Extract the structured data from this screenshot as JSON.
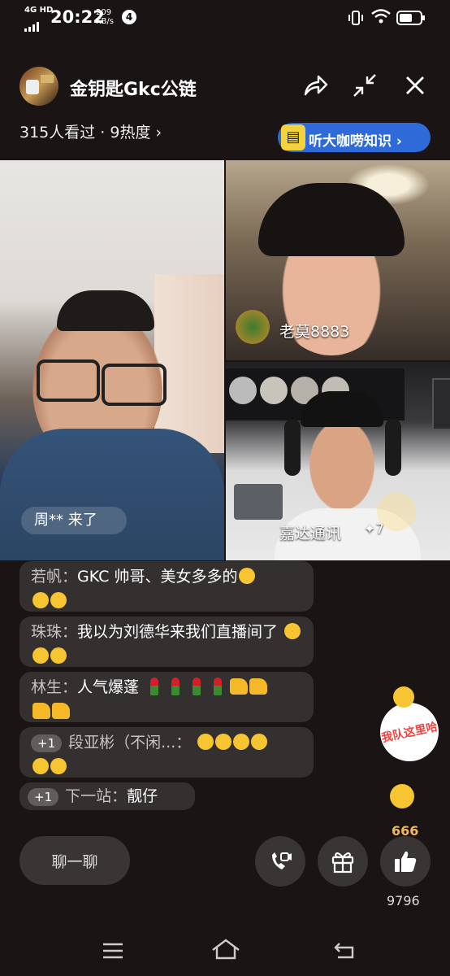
{
  "status_bar": {
    "network": "4G HD",
    "time": "20:22",
    "speed_value": "209",
    "speed_unit": "KB/s",
    "notification_count": "4"
  },
  "header": {
    "title": "金钥匙Gkc公链",
    "stats": "315人看过 · 9热度 ›",
    "promo_label": "听大咖唠知识 ›"
  },
  "videos": {
    "main": {
      "toast": "周** 来了"
    },
    "top_right": {
      "name": "老莫8883"
    },
    "bottom_right": {
      "name": "嘉达通讯",
      "badge": "✦7"
    }
  },
  "chat": [
    {
      "user": "若帆：",
      "text": "GKC 帅哥、美女多多的"
    },
    {
      "user": "珠珠：",
      "text": "我以为刘德华来我们直播间了"
    },
    {
      "user": "林生：",
      "text": "人气爆蓬"
    },
    {
      "plus": "+1",
      "user": "段亚彬（不闲...：",
      "text": ""
    },
    {
      "plus": "+1",
      "user": "下一站：",
      "text": "靓仔"
    }
  ],
  "floating_sticker": {
    "text": "我队这里哈"
  },
  "bottom": {
    "chat_button": "聊一聊",
    "like_count": "9796",
    "like_burst": "666"
  },
  "colors": {
    "promo": "#2f6bd8",
    "background": "#1a1414"
  }
}
